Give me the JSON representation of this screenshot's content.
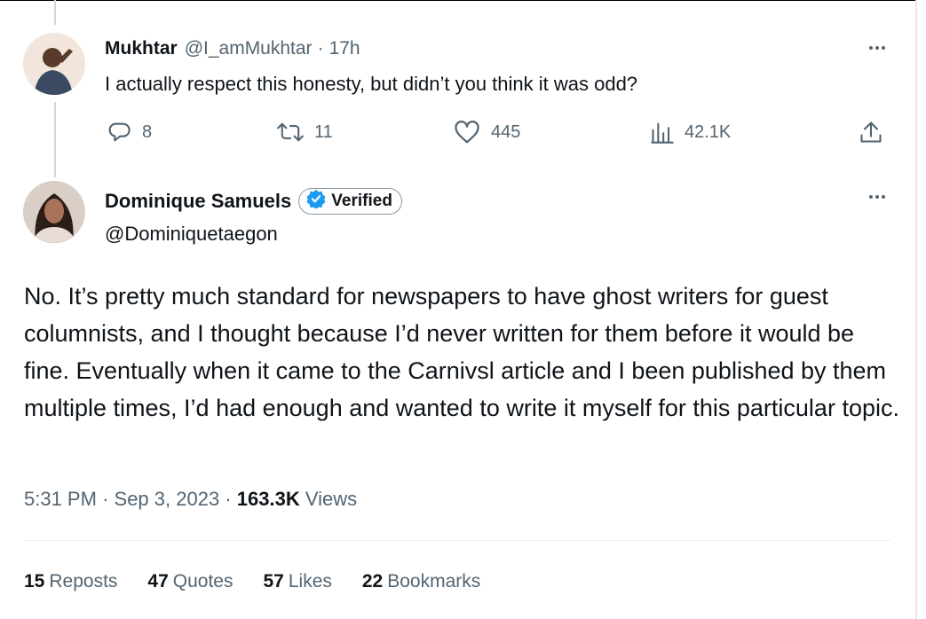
{
  "reply": {
    "display_name": "Mukhtar",
    "handle": "@I_amMukhtar",
    "separator": "·",
    "time": "17h",
    "text": "I actually respect this honesty, but  didn’t you think it was odd?",
    "actions": {
      "replies": "8",
      "reposts": "11",
      "likes": "445",
      "views": "42.1K"
    }
  },
  "main_tweet": {
    "display_name": "Dominique Samuels",
    "verified_label": "Verified",
    "handle": "@Dominiquetaegon",
    "text": "No. It’s pretty much standard for newspapers to have ghost writers for guest columnists, and I thought because I’d never written for them before it would be fine. Eventually when it came to the Carnivsl article and I been published by them multiple times, I’d had enough and wanted to write it myself for this particular topic.",
    "time": "5:31 PM",
    "date": "Sep 3, 2023",
    "dot": "·",
    "views_count": "163.3K",
    "views_label": "Views",
    "stats": [
      {
        "count": "15",
        "label": "Reposts"
      },
      {
        "count": "47",
        "label": "Quotes"
      },
      {
        "count": "57",
        "label": "Likes"
      },
      {
        "count": "22",
        "label": "Bookmarks"
      }
    ]
  },
  "icons": {
    "reply": "speech-bubble-icon",
    "repost": "repost-arrows-icon",
    "like": "heart-icon",
    "views": "bar-chart-icon",
    "share": "share-upload-icon",
    "more": "more-dots-icon",
    "verified": "verified-badge-icon"
  },
  "colors": {
    "text": "#0f1419",
    "muted": "#536471",
    "verified_blue": "#1d9bf0",
    "thread_line": "#cfd9de"
  }
}
